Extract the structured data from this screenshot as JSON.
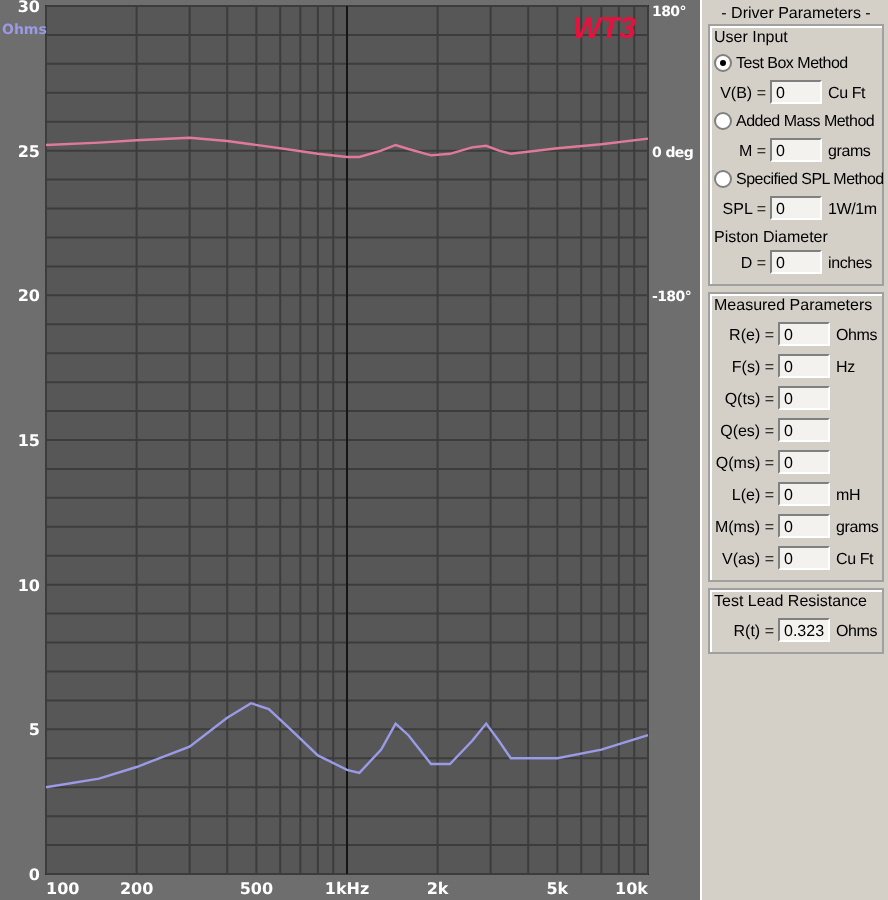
{
  "plot": {
    "logo": "WT3",
    "y_unit": "Ohms",
    "y_labels": [
      "30",
      "25",
      "20",
      "15",
      "10",
      "5",
      "0"
    ],
    "phase_labels": [
      "180°",
      "0 deg",
      "-180°"
    ],
    "x_labels": [
      "100",
      "200",
      "500",
      "1kHz",
      "2k",
      "5k",
      "10k"
    ]
  },
  "driver_parameters": {
    "title": "- Driver Parameters -",
    "user_input": {
      "title": "User Input",
      "items": [
        {
          "kind": "radio",
          "label": "Test Box Method",
          "selected": true
        },
        {
          "kind": "field",
          "label": "V(B) =",
          "value": "0",
          "unit": "Cu Ft"
        },
        {
          "kind": "radio",
          "label": "Added Mass Method",
          "selected": false
        },
        {
          "kind": "field",
          "label": "M =",
          "value": "0",
          "unit": "grams"
        },
        {
          "kind": "radio",
          "label": "Specified SPL Method",
          "selected": false
        },
        {
          "kind": "field",
          "label": "SPL =",
          "value": "0",
          "unit": "1W/1m"
        },
        {
          "kind": "label",
          "label": "Piston Diameter"
        },
        {
          "kind": "field",
          "label": "D =",
          "value": "0",
          "unit": "inches"
        }
      ]
    },
    "measured_parameters": {
      "title": "Measured Parameters",
      "fields": [
        {
          "label": "R(e) =",
          "value": "0",
          "unit": "Ohms"
        },
        {
          "label": "F(s) =",
          "value": "0",
          "unit": "Hz"
        },
        {
          "label": "Q(ts) =",
          "value": "0"
        },
        {
          "label": "Q(es) =",
          "value": "0"
        },
        {
          "label": "Q(ms) =",
          "value": "0"
        },
        {
          "label": "L(e) =",
          "value": "0",
          "unit": "mH"
        },
        {
          "label": "M(ms) =",
          "value": "0",
          "unit": "grams"
        },
        {
          "label": "V(as) =",
          "value": "0",
          "unit": "Cu Ft"
        }
      ]
    },
    "test_lead_resistance": {
      "title": "Test Lead Resistance",
      "fields": [
        {
          "label": "R(t) =",
          "value": "0.323",
          "unit": "Ohms"
        }
      ]
    }
  }
}
